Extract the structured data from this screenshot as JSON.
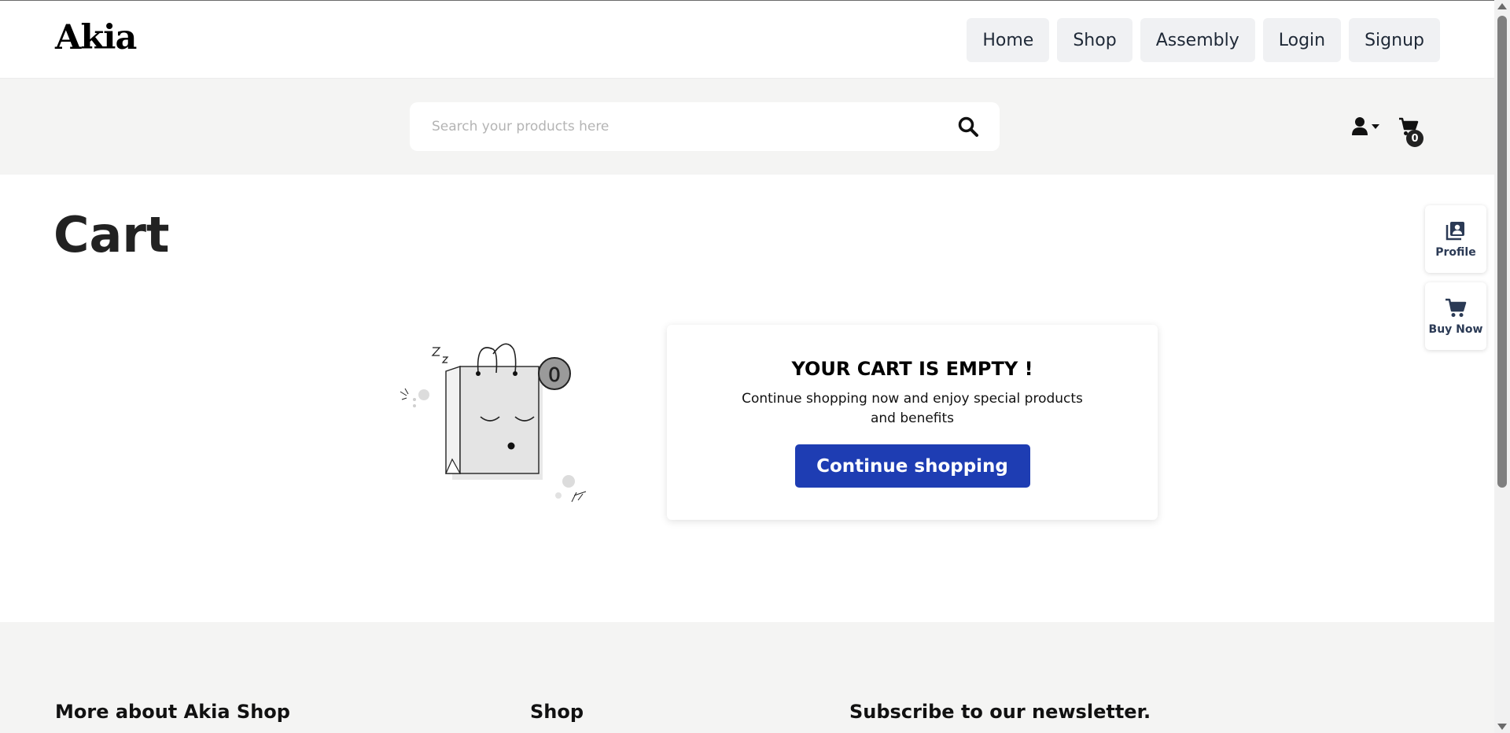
{
  "header": {
    "logo": "Akia",
    "nav": [
      "Home",
      "Shop",
      "Assembly",
      "Login",
      "Signup"
    ]
  },
  "search": {
    "placeholder": "Search your products here",
    "value": ""
  },
  "cart": {
    "count": "0"
  },
  "main": {
    "title": "Cart",
    "badge_number": "0",
    "empty_title": "YOUR CART IS EMPTY !",
    "empty_text": "Continue shopping now and enjoy special products and benefits",
    "continue_label": "Continue shopping"
  },
  "side": {
    "profile_label": "Profile",
    "buy_now_label": "Buy Now"
  },
  "footer": {
    "col1": "More about Akia Shop",
    "col2": "Shop",
    "col3": "Subscribe to our newsletter."
  },
  "colors": {
    "primary_button": "#1e3db3",
    "band_background": "#f4f4f3",
    "nav_button": "#f0f1f3"
  }
}
